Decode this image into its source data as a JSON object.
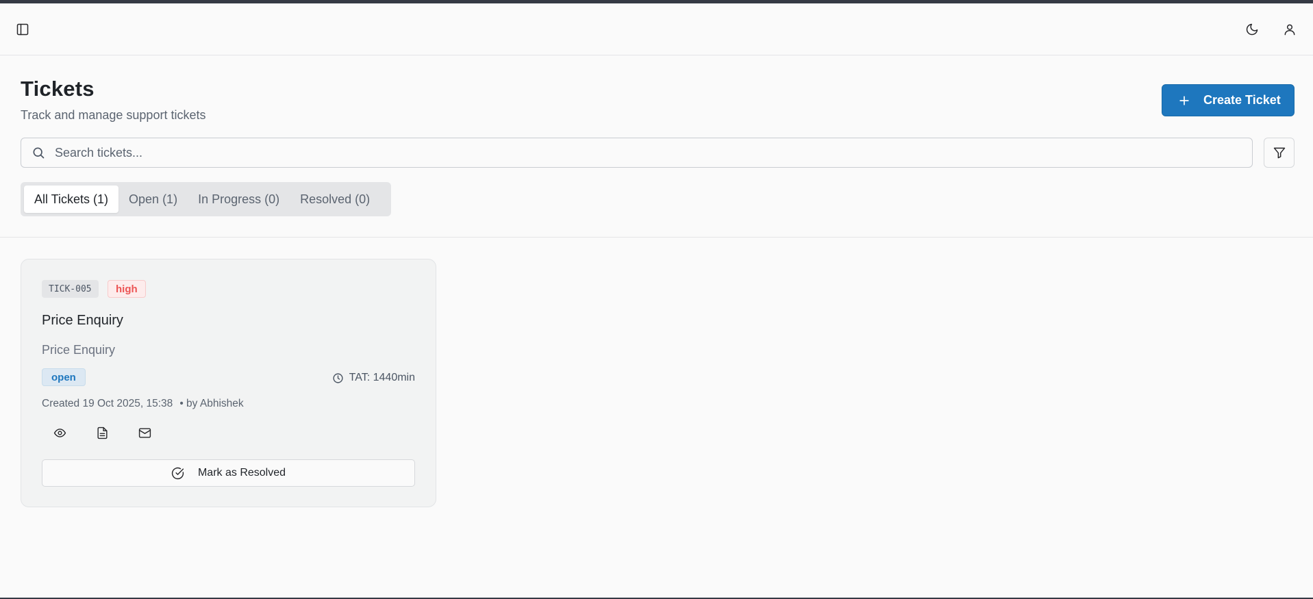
{
  "header": {
    "sidebar_toggle_icon": "panel-left-icon",
    "theme_icon": "moon-icon",
    "user_icon": "user-icon"
  },
  "page": {
    "title": "Tickets",
    "subtitle": "Track and manage support tickets",
    "create_button_label": "Create Ticket",
    "create_button_color": "#1e77be"
  },
  "search": {
    "placeholder": "Search tickets...",
    "value": ""
  },
  "tabs": [
    {
      "label": "All Tickets (1)",
      "active": true
    },
    {
      "label": "Open (1)",
      "active": false
    },
    {
      "label": "In Progress (0)",
      "active": false
    },
    {
      "label": "Resolved (0)",
      "active": false
    }
  ],
  "tickets": [
    {
      "id": "TICK-005",
      "priority": "high",
      "title": "Price Enquiry",
      "description": "Price Enquiry",
      "status": "open",
      "tat": "TAT: 1440min",
      "created": "Created 19 Oct 2025, 15:38",
      "author": "• by Abhishek",
      "resolve_label": "Mark as Resolved",
      "colors": {
        "priority": "#ec5454",
        "status": "#1e77be"
      }
    }
  ]
}
